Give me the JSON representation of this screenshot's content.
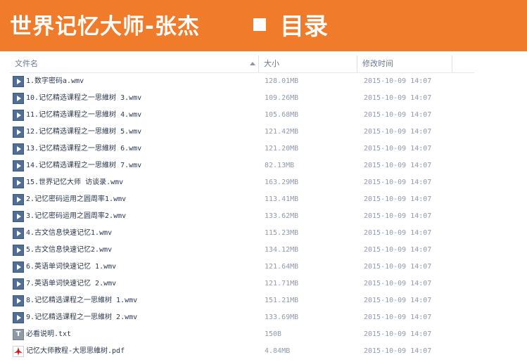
{
  "banner": {
    "title": "世界记忆大师-张杰",
    "catalog": "目录"
  },
  "columns": {
    "name": "文件名",
    "size": "大小",
    "modified": "修改时间"
  },
  "files": [
    {
      "icon": "video-file-icon",
      "name": "1.数字密码a.wmv",
      "size": "128.01MB",
      "modified": "2015-10-09 14:07"
    },
    {
      "icon": "video-file-icon",
      "name": "10.记忆精选课程之一思維树 3.wmv",
      "size": "109.26MB",
      "modified": "2015-10-09 14:07"
    },
    {
      "icon": "video-file-icon",
      "name": "11.记忆精选课程之一思維树 4.wmv",
      "size": "105.68MB",
      "modified": "2015-10-09 14:07"
    },
    {
      "icon": "video-file-icon",
      "name": "12.记忆精选课程之一思維树 5.wmv",
      "size": "121.42MB",
      "modified": "2015-10-09 14:07"
    },
    {
      "icon": "video-file-icon",
      "name": "13.记忆精选课程之一思維树 6.wmv",
      "size": "121.20MB",
      "modified": "2015-10-09 14:07"
    },
    {
      "icon": "video-file-icon",
      "name": "14.记忆精选课程之一思維树 7.wmv",
      "size": "82.13MB",
      "modified": "2015-10-09 14:07"
    },
    {
      "icon": "video-file-icon",
      "name": "15.世界记忆大师 访谈录.wmv",
      "size": "163.29MB",
      "modified": "2015-10-09 14:07"
    },
    {
      "icon": "video-file-icon",
      "name": "2.记忆密码运用之圆周率1.wmv",
      "size": "113.41MB",
      "modified": "2015-10-09 14:07"
    },
    {
      "icon": "video-file-icon",
      "name": "3.记忆密码运用之圆周率2.wmv",
      "size": "133.62MB",
      "modified": "2015-10-09 14:07"
    },
    {
      "icon": "video-file-icon",
      "name": "4.古文信息快速记忆1.wmv",
      "size": "115.23MB",
      "modified": "2015-10-09 14:07"
    },
    {
      "icon": "video-file-icon",
      "name": "5.古文信息快速记忆2.wmv",
      "size": "134.12MB",
      "modified": "2015-10-09 14:07"
    },
    {
      "icon": "video-file-icon",
      "name": "6.英语单词快速记忆 1.wmv",
      "size": "121.64MB",
      "modified": "2015-10-09 14:07"
    },
    {
      "icon": "video-file-icon",
      "name": "7.英语单词快速记忆 2.wmv",
      "size": "121.71MB",
      "modified": "2015-10-09 14:07"
    },
    {
      "icon": "video-file-icon",
      "name": "8.记忆精选课程之一思維树 1.wmv",
      "size": "151.21MB",
      "modified": "2015-10-09 14:07"
    },
    {
      "icon": "video-file-icon",
      "name": "9.记忆精选课程之一思維树 2.wmv",
      "size": "133.69MB",
      "modified": "2015-10-09 14:07"
    },
    {
      "icon": "text-file-icon",
      "name": "必看说明.txt",
      "size": "150B",
      "modified": "2015-10-09 14:07"
    },
    {
      "icon": "pdf-file-icon",
      "name": "记忆大师教程-大思思維树.pdf",
      "size": "4.84MB",
      "modified": "2015-10-09 14:07"
    }
  ]
}
